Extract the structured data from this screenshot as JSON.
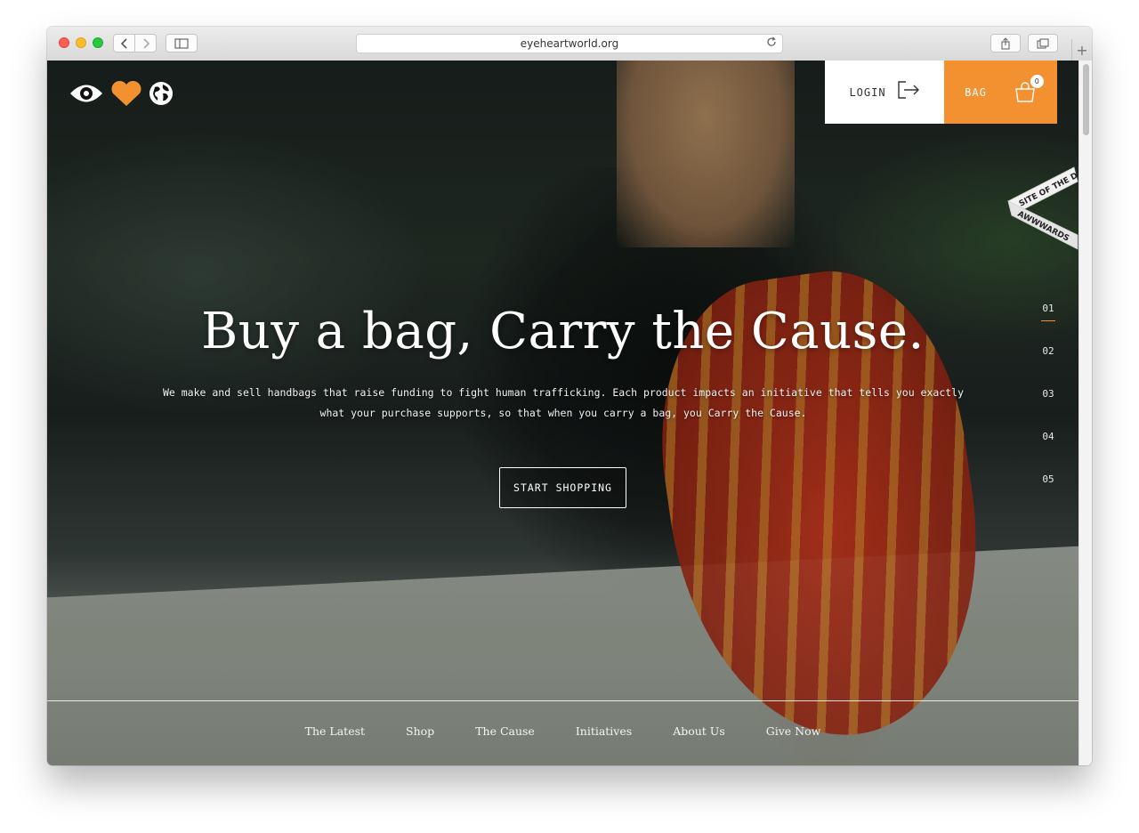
{
  "browser": {
    "url": "eyeheartworld.org",
    "reload_icon": "reload-icon",
    "back_icon": "chevron-left-icon",
    "forward_icon": "chevron-right-icon",
    "sidebar_icon": "sidebar-icon",
    "share_icon": "share-icon",
    "tabs_icon": "tabs-icon",
    "new_tab_label": "+"
  },
  "header": {
    "logo_icons": [
      "eye-icon",
      "heart-icon",
      "globe-icon"
    ],
    "login_label": "LOGIN",
    "bag_label": "BAG",
    "bag_count": "0",
    "accent_color": "#f39131"
  },
  "badge": {
    "line1": "SITE OF THE DAY",
    "line2": "AWWWARDS"
  },
  "hero": {
    "title": "Buy a bag, Carry the Cause.",
    "description": "We make and sell handbags that raise funding to fight human trafficking. Each product impacts an initiative that tells you exactly what your purchase supports, so that when you carry a bag, you Carry the Cause.",
    "cta_label": "START SHOPPING"
  },
  "slides": {
    "items": [
      "01",
      "02",
      "03",
      "04",
      "05"
    ],
    "active": "01"
  },
  "footer_nav": {
    "items": [
      "The Latest",
      "Shop",
      "The Cause",
      "Initiatives",
      "About Us",
      "Give Now"
    ]
  }
}
